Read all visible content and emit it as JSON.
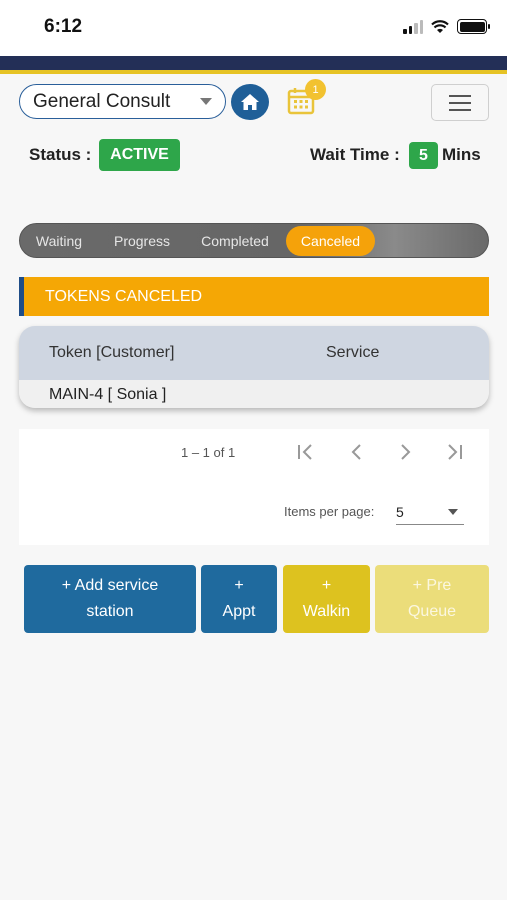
{
  "status_bar": {
    "time": "6:12",
    "signal_icon": "cellular-signal-icon",
    "wifi_icon": "wifi-icon",
    "battery_icon": "battery-icon"
  },
  "header": {
    "department_select": {
      "value": "General Consult"
    },
    "home_icon": "home-icon",
    "calendar_icon": "calendar-icon",
    "calendar_badge": "1",
    "menu_icon": "hamburger-menu-icon"
  },
  "status": {
    "status_label": "Status :",
    "status_value": "ACTIVE",
    "wait_label": "Wait Time :",
    "wait_value": "5",
    "wait_unit": "Mins"
  },
  "tabs": [
    {
      "label": "Waiting",
      "active": false
    },
    {
      "label": "Progress",
      "active": false
    },
    {
      "label": "Completed",
      "active": false
    },
    {
      "label": "Canceled",
      "active": true
    }
  ],
  "section_title": "TOKENS CANCELED",
  "table": {
    "columns": [
      "Token [Customer]",
      "Service"
    ],
    "rows": [
      [
        "MAIN-4 [ Sonia ]",
        ""
      ]
    ]
  },
  "paginator": {
    "range": "1 – 1 of 1",
    "items_per_page_label": "Items per page:",
    "items_per_page_value": "5"
  },
  "actions": [
    {
      "line1": "+ Add service",
      "line2": "station"
    },
    {
      "line1": "+",
      "line2": "Appt"
    },
    {
      "line1": "+",
      "line2": "Walkin"
    },
    {
      "line1": "+ Pre",
      "line2": "Queue"
    }
  ],
  "colors": {
    "brand_navy": "#232f57",
    "accent_yellow": "#e6c325",
    "active_green": "#2ea64a",
    "tab_orange": "#f5a20a",
    "primary_blue": "#1f6a9e"
  }
}
